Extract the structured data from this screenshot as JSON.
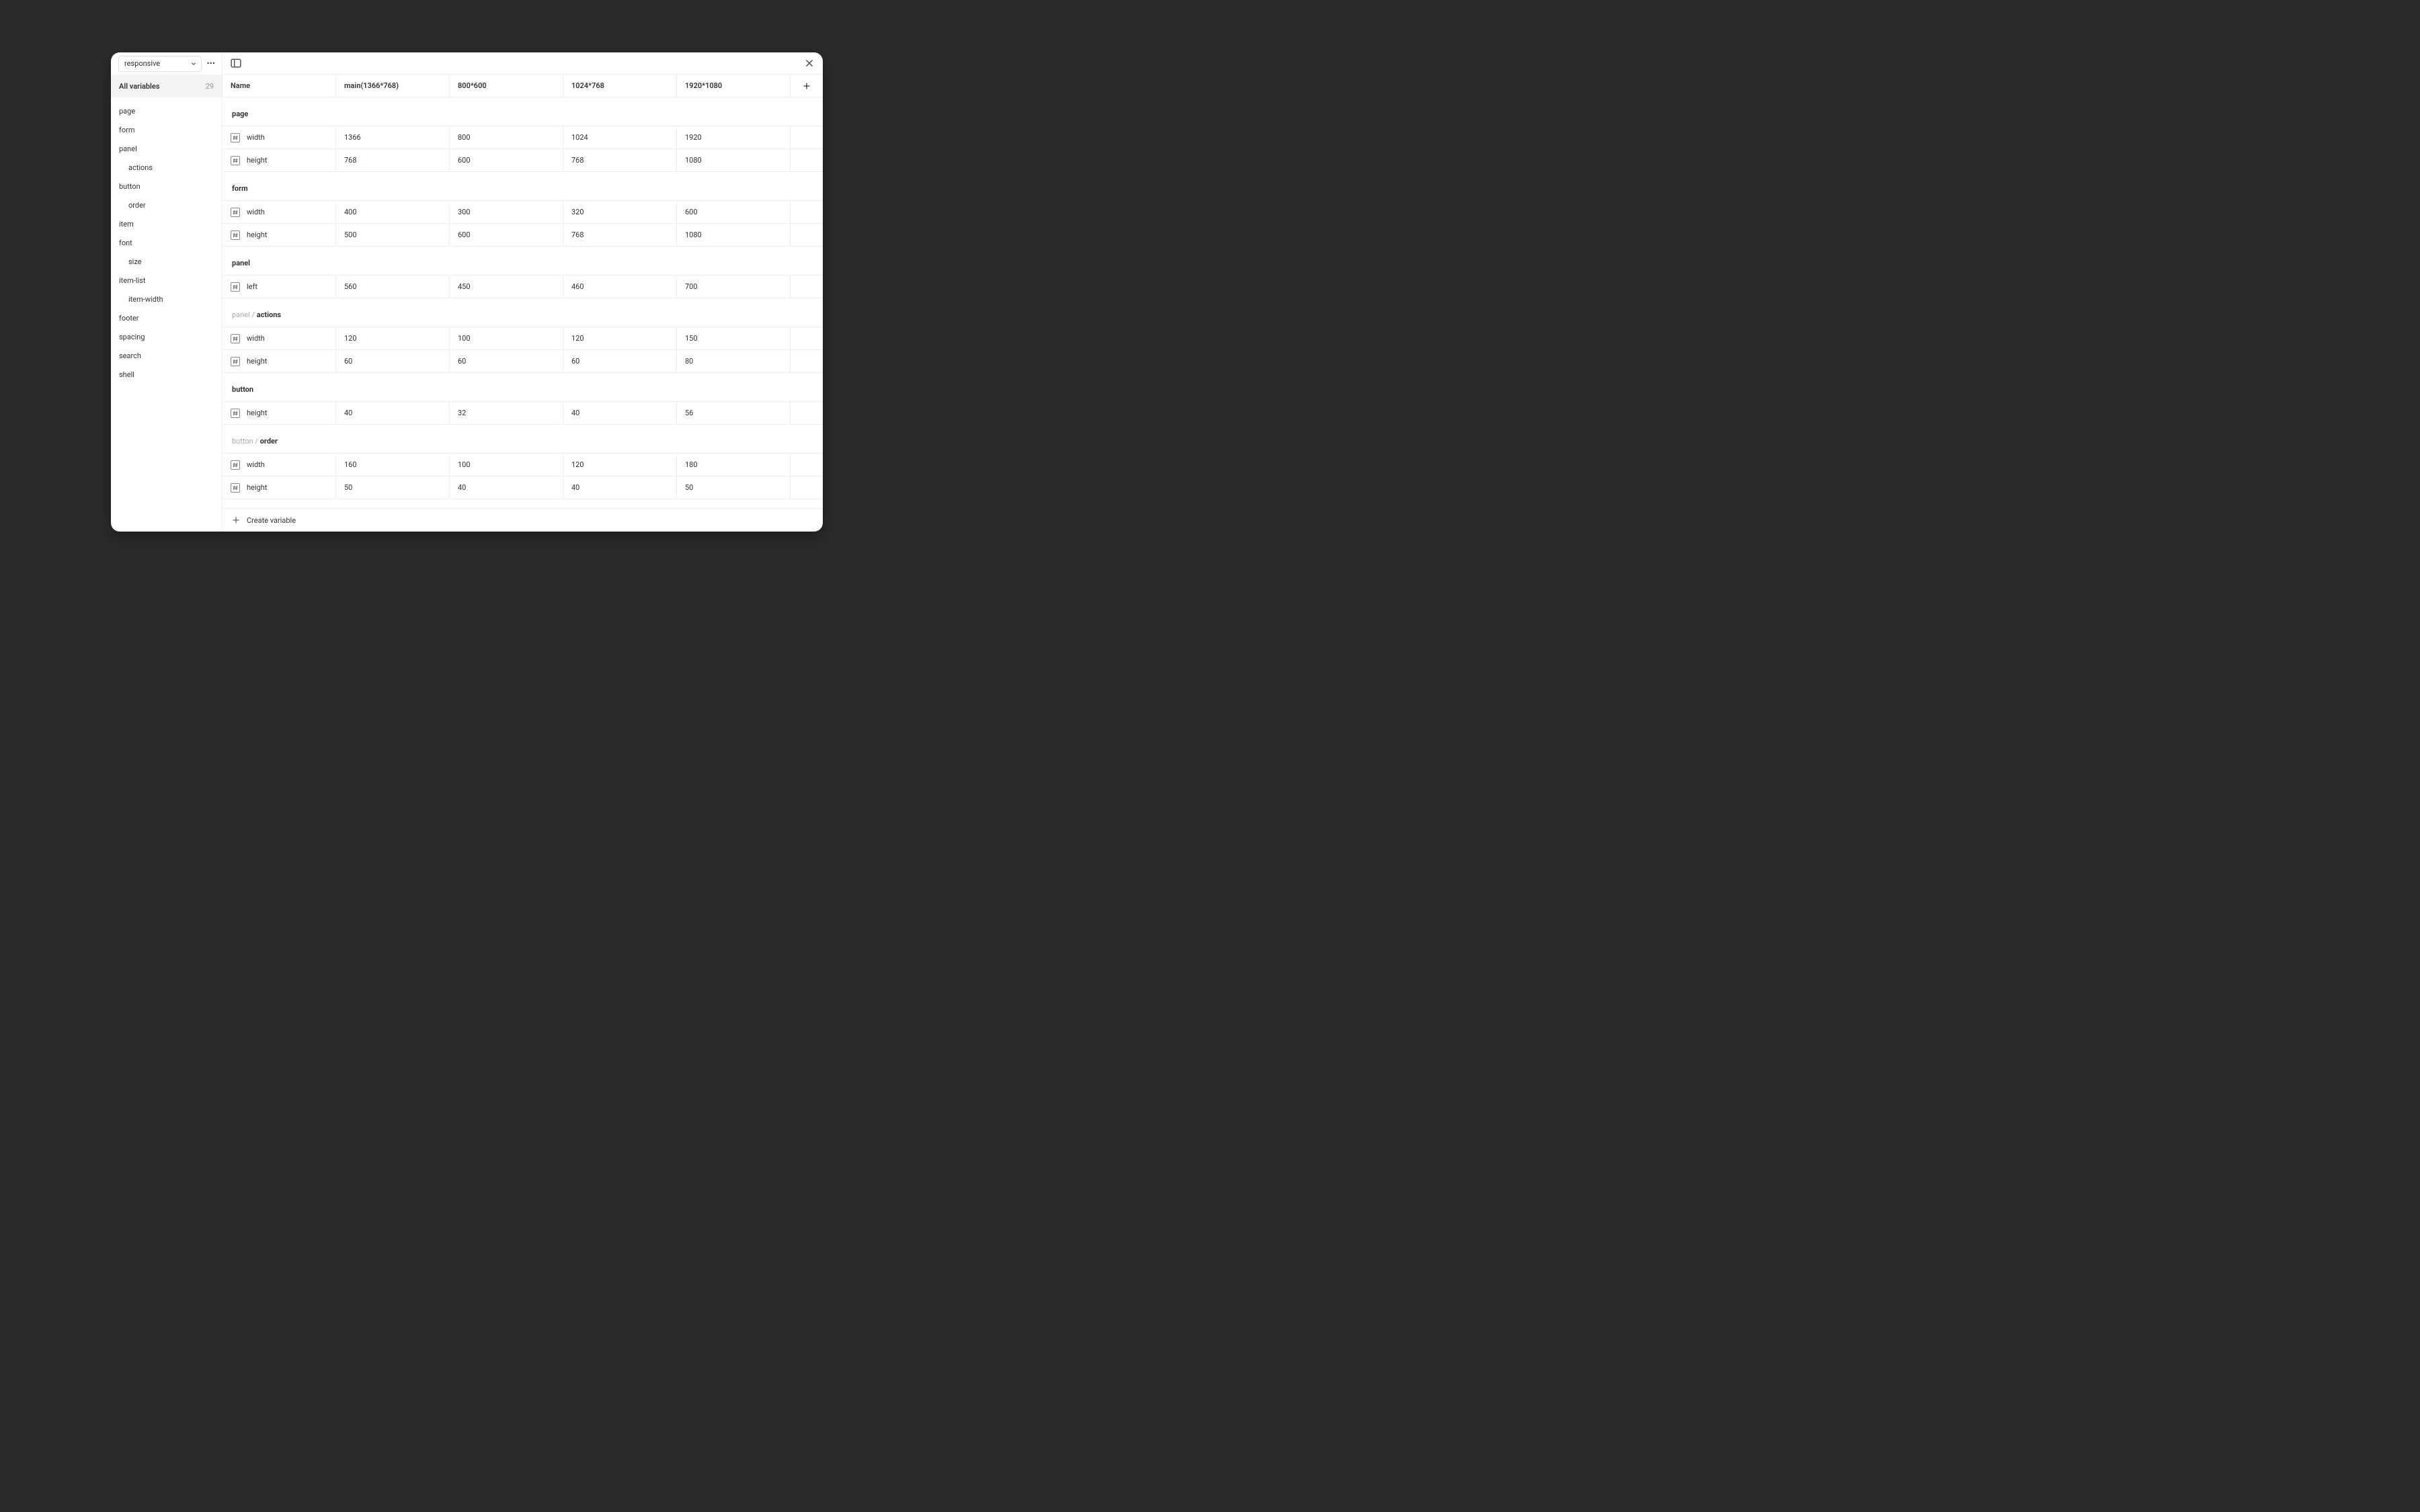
{
  "sidebar": {
    "collection": "responsive",
    "all_label": "All variables",
    "count": 29,
    "items": [
      {
        "label": "page",
        "nested": false
      },
      {
        "label": "form",
        "nested": false
      },
      {
        "label": "panel",
        "nested": false
      },
      {
        "label": "actions",
        "nested": true
      },
      {
        "label": "button",
        "nested": false
      },
      {
        "label": "order",
        "nested": true
      },
      {
        "label": "item",
        "nested": false
      },
      {
        "label": "font",
        "nested": false
      },
      {
        "label": "size",
        "nested": true
      },
      {
        "label": "item-list",
        "nested": false
      },
      {
        "label": "item-width",
        "nested": true
      },
      {
        "label": "footer",
        "nested": false
      },
      {
        "label": "spacing",
        "nested": false
      },
      {
        "label": "search",
        "nested": false
      },
      {
        "label": "shell",
        "nested": false
      }
    ]
  },
  "columns": {
    "name": "Name",
    "modes": [
      "main(1366*768)",
      "800*600",
      "1024*768",
      "1920*1080"
    ]
  },
  "groups": [
    {
      "parent": "",
      "name": "page",
      "rows": [
        {
          "name": "width",
          "vals": [
            "1366",
            "800",
            "1024",
            "1920"
          ]
        },
        {
          "name": "height",
          "vals": [
            "768",
            "600",
            "768",
            "1080"
          ]
        }
      ]
    },
    {
      "parent": "",
      "name": "form",
      "rows": [
        {
          "name": "width",
          "vals": [
            "400",
            "300",
            "320",
            "600"
          ]
        },
        {
          "name": "height",
          "vals": [
            "500",
            "600",
            "768",
            "1080"
          ]
        }
      ]
    },
    {
      "parent": "",
      "name": "panel",
      "rows": [
        {
          "name": "left",
          "vals": [
            "560",
            "450",
            "460",
            "700"
          ]
        }
      ]
    },
    {
      "parent": "panel",
      "name": "actions",
      "rows": [
        {
          "name": "width",
          "vals": [
            "120",
            "100",
            "120",
            "150"
          ]
        },
        {
          "name": "height",
          "vals": [
            "60",
            "60",
            "60",
            "80"
          ]
        }
      ]
    },
    {
      "parent": "",
      "name": "button",
      "rows": [
        {
          "name": "height",
          "vals": [
            "40",
            "32",
            "40",
            "56"
          ]
        }
      ]
    },
    {
      "parent": "button",
      "name": "order",
      "rows": [
        {
          "name": "width",
          "vals": [
            "160",
            "100",
            "120",
            "180"
          ]
        },
        {
          "name": "height",
          "vals": [
            "50",
            "40",
            "40",
            "50"
          ]
        }
      ]
    }
  ],
  "footer": {
    "create": "Create variable"
  }
}
